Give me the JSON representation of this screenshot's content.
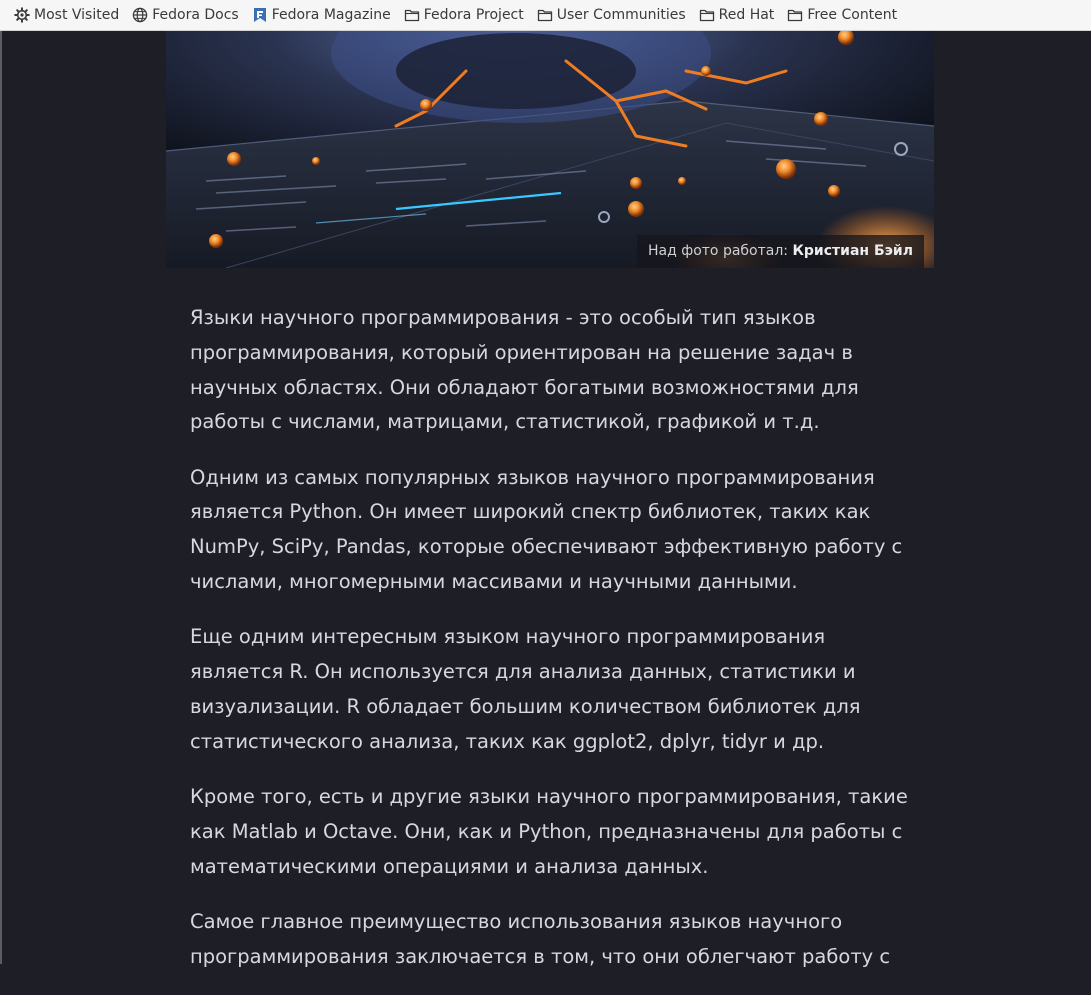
{
  "bookmarks": [
    {
      "label": "Most Visited",
      "icon": "gear-icon"
    },
    {
      "label": "Fedora Docs",
      "icon": "globe-icon"
    },
    {
      "label": "Fedora Magazine",
      "icon": "fedora-magazine-icon"
    },
    {
      "label": "Fedora Project",
      "icon": "folder-icon"
    },
    {
      "label": "User Communities",
      "icon": "folder-icon"
    },
    {
      "label": "Red Hat",
      "icon": "folder-icon"
    },
    {
      "label": "Free Content",
      "icon": "folder-icon"
    }
  ],
  "hero": {
    "caption_prefix": "Над фото работал:",
    "caption_author": "Кристиан Бэйл"
  },
  "article": {
    "paragraphs": [
      "Языки научного программирования - это особый тип языков программирования, который ориентирован на решение задач в научных областях. Они обладают богатыми возможностями для работы с числами, матрицами, статистикой, графикой и т.д.",
      "Одним из самых популярных языков научного программирования является Python. Он имеет широкий спектр библиотек, таких как NumPy, SciPy, Pandas, которые обеспечивают эффективную работу с числами, многомерными массивами и научными данными.",
      "Еще одним интересным языком научного программирования является R. Он используется для анализа данных, статистики и визуализации. R обладает большим количеством библиотек для статистического анализа, таких как ggplot2, dplyr, tidyr и др.",
      "Кроме того, есть и другие языки научного программирования, такие как Matlab и Octave. Они, как и Python, предназначены для работы с математическими операциями и анализа данных.",
      "Самое главное преимущество использования языков научного программирования заключается в том, что они облегчают работу с"
    ]
  },
  "colors": {
    "page_background": "#1e1f26",
    "article_text": "#d7d8dd",
    "bookmarks_background": "#f6f6f6",
    "hero_accent": "#f08a2a"
  }
}
